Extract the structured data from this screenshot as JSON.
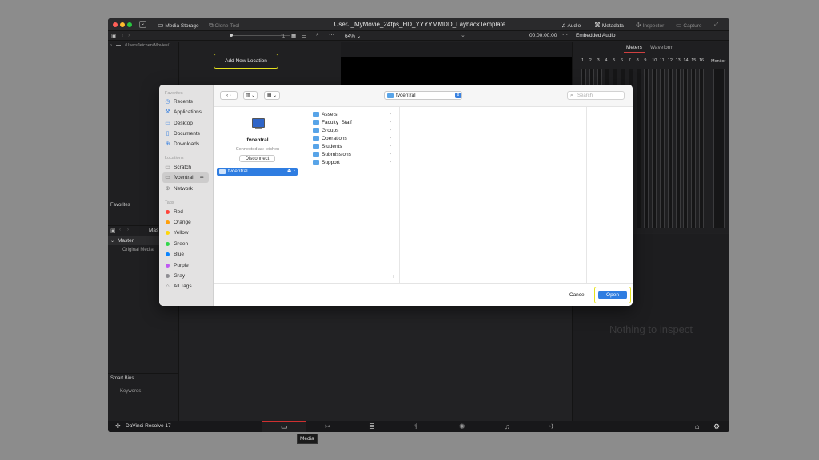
{
  "window": {
    "title": "UserJ_MyMovie_24fps_HD_YYYYMMDD_LaybackTemplate",
    "tabs": [
      "Media Storage",
      "Clone Tool"
    ],
    "right_tabs": [
      "Audio",
      "Metadata",
      "Inspector",
      "Capture"
    ]
  },
  "toolbar": {
    "zoom": "64%",
    "timecode": "00:00:00:00"
  },
  "storage": {
    "path": "/Users/leichen/Movies/...",
    "add_location_label": "Add New Location",
    "favorites_label": "Favorites"
  },
  "media_pool": {
    "master_short": "Mas",
    "master_label": "Master",
    "original_media": "Original Media",
    "smart_bins": "Smart Bins",
    "keywords": "Keywords"
  },
  "audio_panel": {
    "title": "Embedded Audio",
    "tabs": [
      "Meters",
      "Waveform"
    ],
    "channels": [
      "1",
      "2",
      "3",
      "4",
      "5",
      "6",
      "7",
      "8",
      "9",
      "10",
      "11",
      "12",
      "13",
      "14",
      "15",
      "16"
    ],
    "monitor_label": "Monitor"
  },
  "inspector": {
    "empty_text": "Nothing to inspect"
  },
  "dock": {
    "app_name": "DaVinci Resolve 17",
    "tooltip": "Media"
  },
  "dialog": {
    "location_popup": "fvcentral",
    "search_placeholder": "Search",
    "sidebar": {
      "favorites_head": "Favorites",
      "favorites": [
        "Recents",
        "Applications",
        "Desktop",
        "Documents",
        "Downloads"
      ],
      "locations_head": "Locations",
      "locations": [
        "Scratch",
        "fvcentral",
        "Network"
      ],
      "tags_head": "Tags",
      "tags": [
        {
          "label": "Red",
          "color": "#ff453a"
        },
        {
          "label": "Orange",
          "color": "#ff9f0a"
        },
        {
          "label": "Yellow",
          "color": "#ffd60a"
        },
        {
          "label": "Green",
          "color": "#32d74b"
        },
        {
          "label": "Blue",
          "color": "#0a84ff"
        },
        {
          "label": "Purple",
          "color": "#bf5af2"
        },
        {
          "label": "Gray",
          "color": "#8e8e93"
        }
      ],
      "all_tags": "All Tags..."
    },
    "server": {
      "name": "fvcentral",
      "connected_as": "Connected as: leichen",
      "disconnect_label": "Disconnect",
      "selected_item": "fvcentral"
    },
    "folders": [
      "Assets",
      "Faculty_Staff",
      "Groups",
      "Operations",
      "Students",
      "Submissions",
      "Support"
    ],
    "cancel_label": "Cancel",
    "open_label": "Open"
  },
  "colors": {
    "accent": "#2f7de1",
    "highlight_outline": "#e6e21e"
  }
}
